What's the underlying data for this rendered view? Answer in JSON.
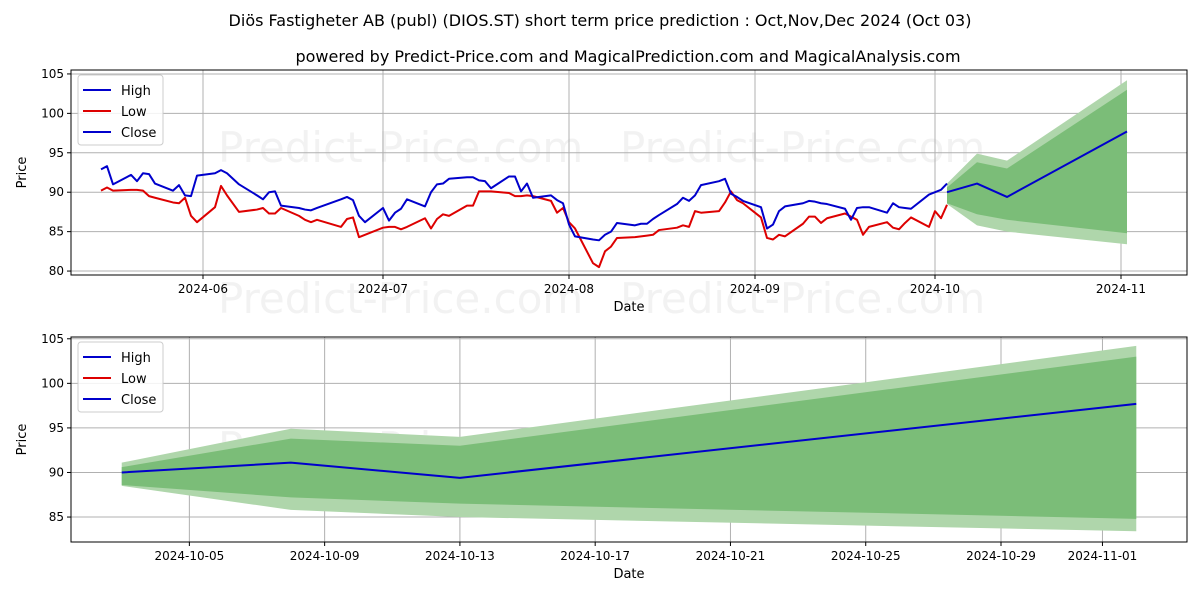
{
  "title": "Diös Fastigheter AB (publ) (DIOS.ST) short term price prediction : Oct,Nov,Dec 2024 (Oct 03)",
  "subtitle": "powered by Predict-Price.com and MagicalPrediction.com and MagicalAnalysis.com",
  "watermark": "Predict-Price.com",
  "colors": {
    "high": "#0000cc",
    "low": "#dd0000",
    "close": "#0000cc",
    "band_outer": "#afd6ab",
    "band_inner": "#7bbd78",
    "grid": "#b0b0b0"
  },
  "chart_data": [
    {
      "type": "line",
      "name": "history",
      "xlabel": "Date",
      "ylabel": "Price",
      "ylim": [
        79.5,
        105.5
      ],
      "xlim": [
        "2024-05-10",
        "2024-11-12"
      ],
      "yticks": [
        80,
        85,
        90,
        95,
        100,
        105
      ],
      "xticks": [
        "2024-06",
        "2024-07",
        "2024-08",
        "2024-09",
        "2024-10",
        "2024-11"
      ],
      "xtick_dates": [
        "2024-06-01",
        "2024-07-01",
        "2024-08-01",
        "2024-09-01",
        "2024-10-01",
        "2024-11-01"
      ],
      "grid": true,
      "legend": {
        "position": "top-left",
        "entries": [
          "High",
          "Low",
          "Close"
        ]
      },
      "dates": [
        "2024-05-15",
        "2024-05-16",
        "2024-05-17",
        "2024-05-20",
        "2024-05-21",
        "2024-05-22",
        "2024-05-23",
        "2024-05-24",
        "2024-05-27",
        "2024-05-28",
        "2024-05-29",
        "2024-05-30",
        "2024-05-31",
        "2024-06-03",
        "2024-06-04",
        "2024-06-05",
        "2024-06-07",
        "2024-06-10",
        "2024-06-11",
        "2024-06-12",
        "2024-06-13",
        "2024-06-14",
        "2024-06-17",
        "2024-06-18",
        "2024-06-19",
        "2024-06-20",
        "2024-06-24",
        "2024-06-25",
        "2024-06-26",
        "2024-06-27",
        "2024-06-28",
        "2024-07-01",
        "2024-07-02",
        "2024-07-03",
        "2024-07-04",
        "2024-07-05",
        "2024-07-08",
        "2024-07-09",
        "2024-07-10",
        "2024-07-11",
        "2024-07-12",
        "2024-07-15",
        "2024-07-16",
        "2024-07-17",
        "2024-07-18",
        "2024-07-19",
        "2024-07-22",
        "2024-07-23",
        "2024-07-24",
        "2024-07-25",
        "2024-07-26",
        "2024-07-29",
        "2024-07-30",
        "2024-07-31",
        "2024-08-01",
        "2024-08-02",
        "2024-08-05",
        "2024-08-06",
        "2024-08-07",
        "2024-08-08",
        "2024-08-09",
        "2024-08-12",
        "2024-08-13",
        "2024-08-14",
        "2024-08-15",
        "2024-08-16",
        "2024-08-19",
        "2024-08-20",
        "2024-08-21",
        "2024-08-22",
        "2024-08-23",
        "2024-08-26",
        "2024-08-27",
        "2024-08-28",
        "2024-08-29",
        "2024-08-30",
        "2024-09-02",
        "2024-09-03",
        "2024-09-04",
        "2024-09-05",
        "2024-09-06",
        "2024-09-09",
        "2024-09-10",
        "2024-09-11",
        "2024-09-12",
        "2024-09-13",
        "2024-09-16",
        "2024-09-17",
        "2024-09-18",
        "2024-09-19",
        "2024-09-20",
        "2024-09-23",
        "2024-09-24",
        "2024-09-25",
        "2024-09-26",
        "2024-09-27",
        "2024-09-30",
        "2024-10-01",
        "2024-10-02",
        "2024-10-03"
      ],
      "high": [
        92.9,
        93.3,
        91.0,
        92.2,
        91.4,
        92.4,
        92.3,
        91.1,
        90.2,
        90.9,
        89.6,
        89.5,
        92.1,
        92.4,
        92.8,
        92.4,
        91.0,
        89.6,
        89.1,
        90.0,
        90.1,
        88.3,
        88.0,
        87.8,
        87.7,
        88.0,
        89.1,
        89.4,
        89.0,
        87.0,
        86.2,
        88.0,
        86.4,
        87.4,
        87.9,
        89.1,
        88.2,
        90.0,
        91.0,
        91.1,
        91.7,
        91.9,
        91.9,
        91.5,
        91.4,
        90.5,
        92.0,
        92.0,
        90.1,
        91.1,
        89.3,
        89.6,
        89.0,
        88.6,
        85.9,
        84.4,
        84.0,
        83.9,
        84.6,
        85.0,
        86.1,
        85.8,
        86.0,
        86.0,
        86.6,
        87.1,
        88.5,
        89.3,
        88.9,
        89.6,
        90.9,
        91.4,
        91.7,
        89.8,
        89.4,
        88.9,
        88.1,
        85.4,
        85.9,
        87.6,
        88.2,
        88.6,
        88.9,
        88.8,
        88.6,
        88.5,
        87.9,
        86.5,
        88.0,
        88.1,
        88.1,
        87.4,
        88.6,
        88.1,
        88.0,
        87.9,
        89.7,
        90.0,
        90.3,
        91.1
      ],
      "low": [
        90.2,
        90.6,
        90.2,
        90.3,
        90.3,
        90.2,
        89.5,
        89.3,
        88.7,
        88.6,
        89.3,
        87.0,
        86.2,
        88.1,
        90.8,
        89.6,
        87.5,
        87.8,
        88.0,
        87.3,
        87.3,
        88.0,
        87.0,
        86.5,
        86.2,
        86.5,
        85.6,
        86.6,
        86.8,
        84.3,
        84.6,
        85.5,
        85.6,
        85.6,
        85.3,
        85.6,
        86.7,
        85.4,
        86.6,
        87.2,
        87.0,
        88.3,
        88.3,
        90.1,
        90.1,
        90.1,
        89.9,
        89.5,
        89.5,
        89.6,
        89.5,
        88.9,
        87.4,
        88.0,
        86.2,
        85.4,
        81.0,
        80.5,
        82.5,
        83.1,
        84.2,
        84.3,
        84.4,
        84.5,
        84.6,
        85.2,
        85.5,
        85.8,
        85.6,
        87.6,
        87.4,
        87.6,
        88.7,
        90.1,
        89.0,
        88.6,
        86.8,
        84.2,
        84.0,
        84.6,
        84.4,
        86.0,
        86.9,
        86.9,
        86.1,
        86.7,
        87.3,
        86.9,
        86.5,
        84.6,
        85.6,
        86.2,
        85.5,
        85.3,
        86.1,
        86.8,
        85.6,
        87.6,
        86.7,
        88.4
      ],
      "close": [
        92.9,
        93.3,
        91.0,
        92.2,
        91.4,
        92.4,
        92.3,
        91.1,
        90.2,
        90.9,
        89.6,
        89.5,
        92.1,
        92.4,
        92.8,
        92.4,
        91.0,
        89.6,
        89.1,
        90.0,
        90.1,
        88.3,
        88.0,
        87.8,
        87.7,
        88.0,
        89.1,
        89.4,
        89.0,
        87.0,
        86.2,
        88.0,
        86.4,
        87.4,
        87.9,
        89.1,
        88.2,
        90.0,
        91.0,
        91.1,
        91.7,
        91.9,
        91.9,
        91.5,
        91.4,
        90.5,
        92.0,
        92.0,
        90.1,
        91.1,
        89.3,
        89.6,
        89.0,
        88.6,
        85.9,
        84.4,
        84.0,
        83.9,
        84.6,
        85.0,
        86.1,
        85.8,
        86.0,
        86.0,
        86.6,
        87.1,
        88.5,
        89.3,
        88.9,
        89.6,
        90.9,
        91.4,
        91.7,
        89.8,
        89.4,
        88.9,
        88.1,
        85.4,
        85.9,
        87.6,
        88.2,
        88.6,
        88.9,
        88.8,
        88.6,
        88.5,
        87.9,
        86.5,
        88.0,
        88.1,
        88.1,
        87.4,
        88.6,
        88.1,
        88.0,
        87.9,
        89.7,
        90.0,
        90.3,
        91.1
      ],
      "forecast": {
        "dates": [
          "2024-10-03",
          "2024-10-08",
          "2024-10-13",
          "2024-11-02"
        ],
        "close": [
          90.0,
          91.1,
          89.4,
          97.7
        ],
        "inner_upper": [
          90.6,
          93.8,
          93.0,
          103.0
        ],
        "inner_lower": [
          88.6,
          87.2,
          86.5,
          84.8
        ],
        "outer_upper": [
          91.1,
          94.9,
          94.0,
          104.2
        ],
        "outer_lower": [
          88.5,
          85.8,
          85.0,
          83.4
        ]
      }
    },
    {
      "type": "area",
      "name": "forecast-zoom",
      "xlabel": "Date",
      "ylabel": "Price",
      "ylim": [
        82.2,
        105.2
      ],
      "xlim": [
        "2024-10-01.5",
        "2024-11-03.5"
      ],
      "yticks": [
        85,
        90,
        95,
        100,
        105
      ],
      "xticks": [
        "2024-10-05",
        "2024-10-09",
        "2024-10-13",
        "2024-10-17",
        "2024-10-21",
        "2024-10-25",
        "2024-10-29",
        "2024-11-01"
      ],
      "grid": true,
      "legend": {
        "position": "top-left",
        "entries": [
          "High",
          "Low",
          "Close"
        ]
      },
      "dates": [
        "2024-10-03",
        "2024-10-08",
        "2024-10-13",
        "2024-11-02"
      ],
      "close": [
        90.0,
        91.1,
        89.4,
        97.7
      ],
      "inner_upper": [
        90.6,
        93.8,
        93.0,
        103.0
      ],
      "inner_lower": [
        88.6,
        87.2,
        86.5,
        84.8
      ],
      "outer_upper": [
        91.1,
        94.9,
        94.0,
        104.2
      ],
      "outer_lower": [
        88.5,
        85.8,
        85.0,
        83.4
      ]
    }
  ]
}
